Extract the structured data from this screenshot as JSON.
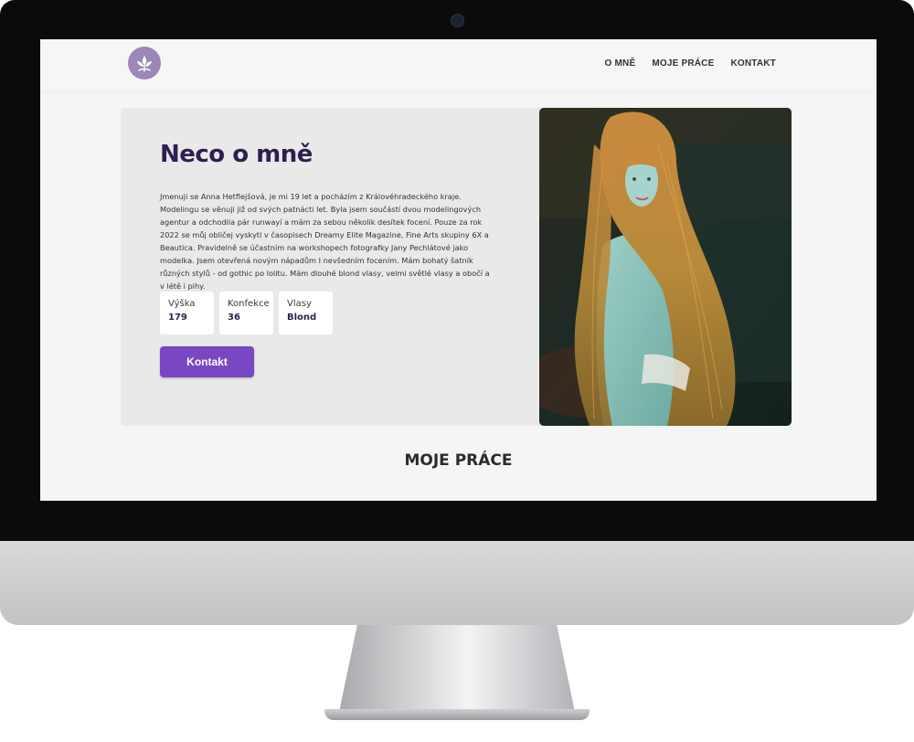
{
  "nav": {
    "items": [
      "O MNĚ",
      "MOJE PRÁCE",
      "KONTAKT"
    ]
  },
  "hero": {
    "title": "Neco o mně",
    "text": "Jmenuji se Anna Hetflejšová, je mi 19 let a pocházím z Královéhradeckého kraje. Modelingu se věnuji již od svých patnácti let. Byla jsem součástí dvou modelingových agentur a odchodila pár runwayí a mám za sebou několik desítek focení. Pouze za rok 2022 se můj obličej vyskytl v časopisech Dreamy Elite Magazine, Fine Arts skupiny 6X a Beautica. Pravidelně se účastním na workshopech fotografky Jany Pechlátové jako modelka. Jsem otevřená novým nápadům I nevšedním focením. Mám bohatý šatník různých stylů - od gothic po lolitu. Mám dlouhé blond vlasy, velmi světlé vlasy a obočí a v létě i pihy.",
    "stats": [
      {
        "label": "Výška",
        "value": "179"
      },
      {
        "label": "Konfekce",
        "value": "36"
      },
      {
        "label": "Vlasy",
        "value": "Blond"
      }
    ],
    "button_label": "Kontakt"
  },
  "section_title": "MOJE PRÁCE",
  "icons": {
    "logo": "leaf-logo-icon",
    "camera": "webcam-icon"
  },
  "colors": {
    "accent": "#7a47c2",
    "title": "#2e1f4f",
    "logo": "#9d86b8",
    "card": "#e9e9e9"
  }
}
